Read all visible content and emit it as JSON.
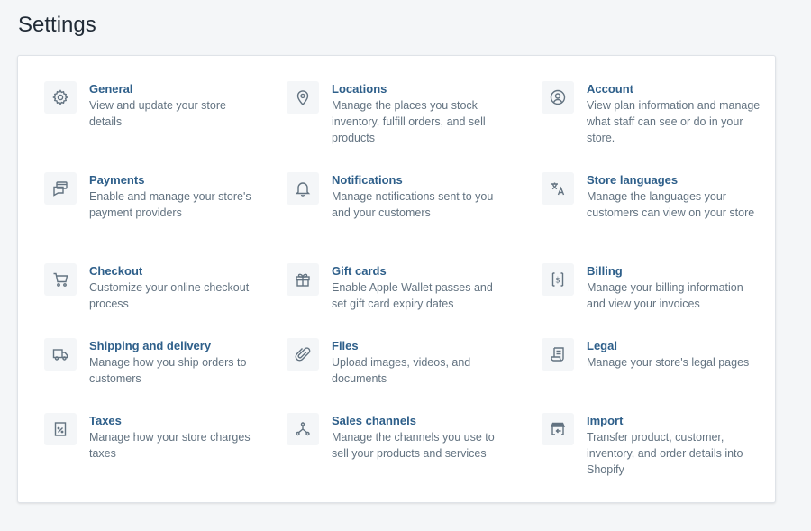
{
  "page": {
    "title": "Settings"
  },
  "items": [
    {
      "key": "general",
      "title": "General",
      "desc": "View and update your store details"
    },
    {
      "key": "locations",
      "title": "Locations",
      "desc": "Manage the places you stock inventory, fulfill orders, and sell products"
    },
    {
      "key": "account",
      "title": "Account",
      "desc": "View plan information and manage what staff can see or do in your store."
    },
    {
      "key": "payments",
      "title": "Payments",
      "desc": "Enable and manage your store's payment providers"
    },
    {
      "key": "notifications",
      "title": "Notifications",
      "desc": "Manage notifications sent to you and your customers"
    },
    {
      "key": "store-languages",
      "title": "Store languages",
      "desc": "Manage the languages your customers can view on your store"
    },
    {
      "key": "checkout",
      "title": "Checkout",
      "desc": "Customize your online checkout process"
    },
    {
      "key": "gift-cards",
      "title": "Gift cards",
      "desc": "Enable Apple Wallet passes and set gift card expiry dates"
    },
    {
      "key": "billing",
      "title": "Billing",
      "desc": "Manage your billing information and view your invoices"
    },
    {
      "key": "shipping",
      "title": "Shipping and delivery",
      "desc": "Manage how you ship orders to customers"
    },
    {
      "key": "files",
      "title": "Files",
      "desc": "Upload images, videos, and documents"
    },
    {
      "key": "legal",
      "title": "Legal",
      "desc": "Manage your store's legal pages"
    },
    {
      "key": "taxes",
      "title": "Taxes",
      "desc": "Manage how your store charges taxes"
    },
    {
      "key": "sales-channels",
      "title": "Sales channels",
      "desc": "Manage the channels you use to sell your products and services"
    },
    {
      "key": "import",
      "title": "Import",
      "desc": "Transfer product, customer, inventory, and order details into Shopify"
    }
  ],
  "icons": [
    "gear-icon",
    "location-pin-icon",
    "account-icon",
    "payments-icon",
    "bell-icon",
    "translate-icon",
    "cart-icon",
    "gift-icon",
    "billing-icon",
    "truck-icon",
    "paperclip-icon",
    "legal-icon",
    "taxes-icon",
    "sales-channels-icon",
    "import-icon"
  ],
  "colors": {
    "link": "#2e5f8a",
    "muted": "#637381",
    "icon": "#637381",
    "background": "#f4f6f8",
    "card": "#ffffff"
  }
}
